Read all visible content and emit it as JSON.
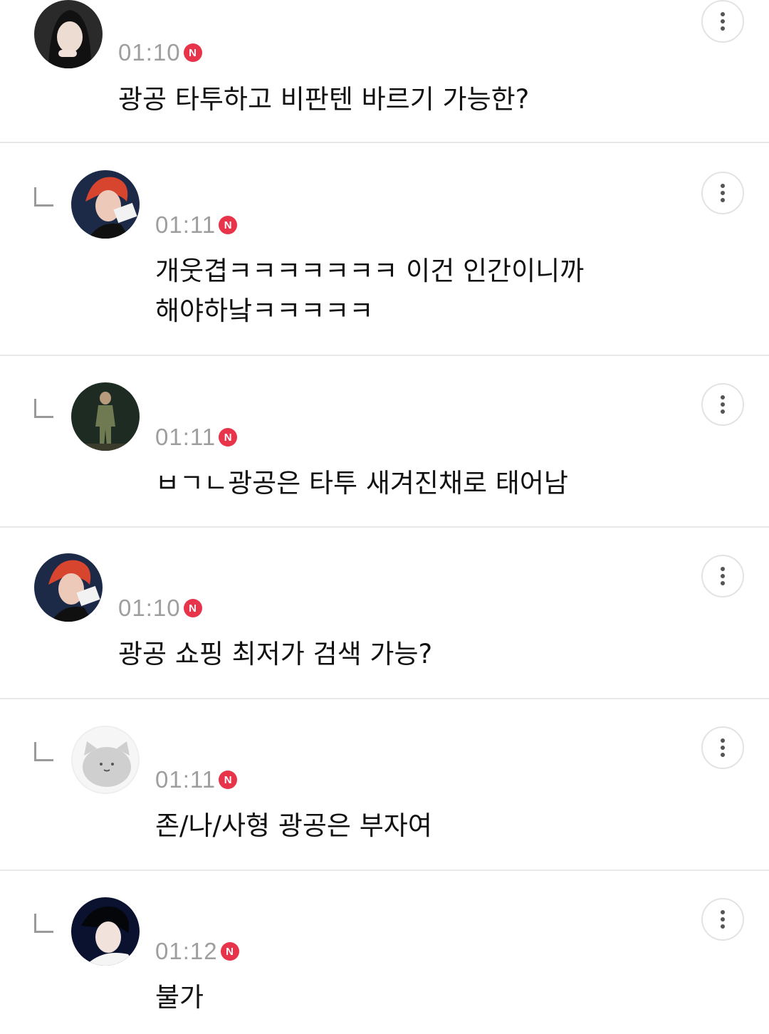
{
  "comments": [
    {
      "time": "01:10",
      "badge": "N",
      "text": "광공 타투하고 비판텐 바르기 가능한?",
      "reply": false,
      "avatar_icon": "user-photo-avatar"
    },
    {
      "time": "01:11",
      "badge": "N",
      "text": "개웃겹ㅋㅋㅋㅋㅋㅋㅋ 이건 인간이니까\n해야하낰ㅋㅋㅋㅋㅋ",
      "reply": true,
      "avatar_icon": "user-photo-avatar"
    },
    {
      "time": "01:11",
      "badge": "N",
      "text": "ㅂㄱㄴ광공은 타투 새겨진채로 태어남",
      "reply": true,
      "avatar_icon": "user-photo-avatar"
    },
    {
      "time": "01:10",
      "badge": "N",
      "text": "광공 쇼핑 최저가 검색 가능?",
      "reply": false,
      "avatar_icon": "user-photo-avatar"
    },
    {
      "time": "01:11",
      "badge": "N",
      "text": "존/나/사형 광공은 부자여",
      "reply": true,
      "avatar_icon": "default-cat-avatar"
    },
    {
      "time": "01:12",
      "badge": "N",
      "text": "불가",
      "reply": true,
      "avatar_icon": "user-photo-avatar"
    }
  ],
  "colors": {
    "badge": "#e8344b",
    "time": "#9e9e9e",
    "divider": "#e8e8e8"
  }
}
